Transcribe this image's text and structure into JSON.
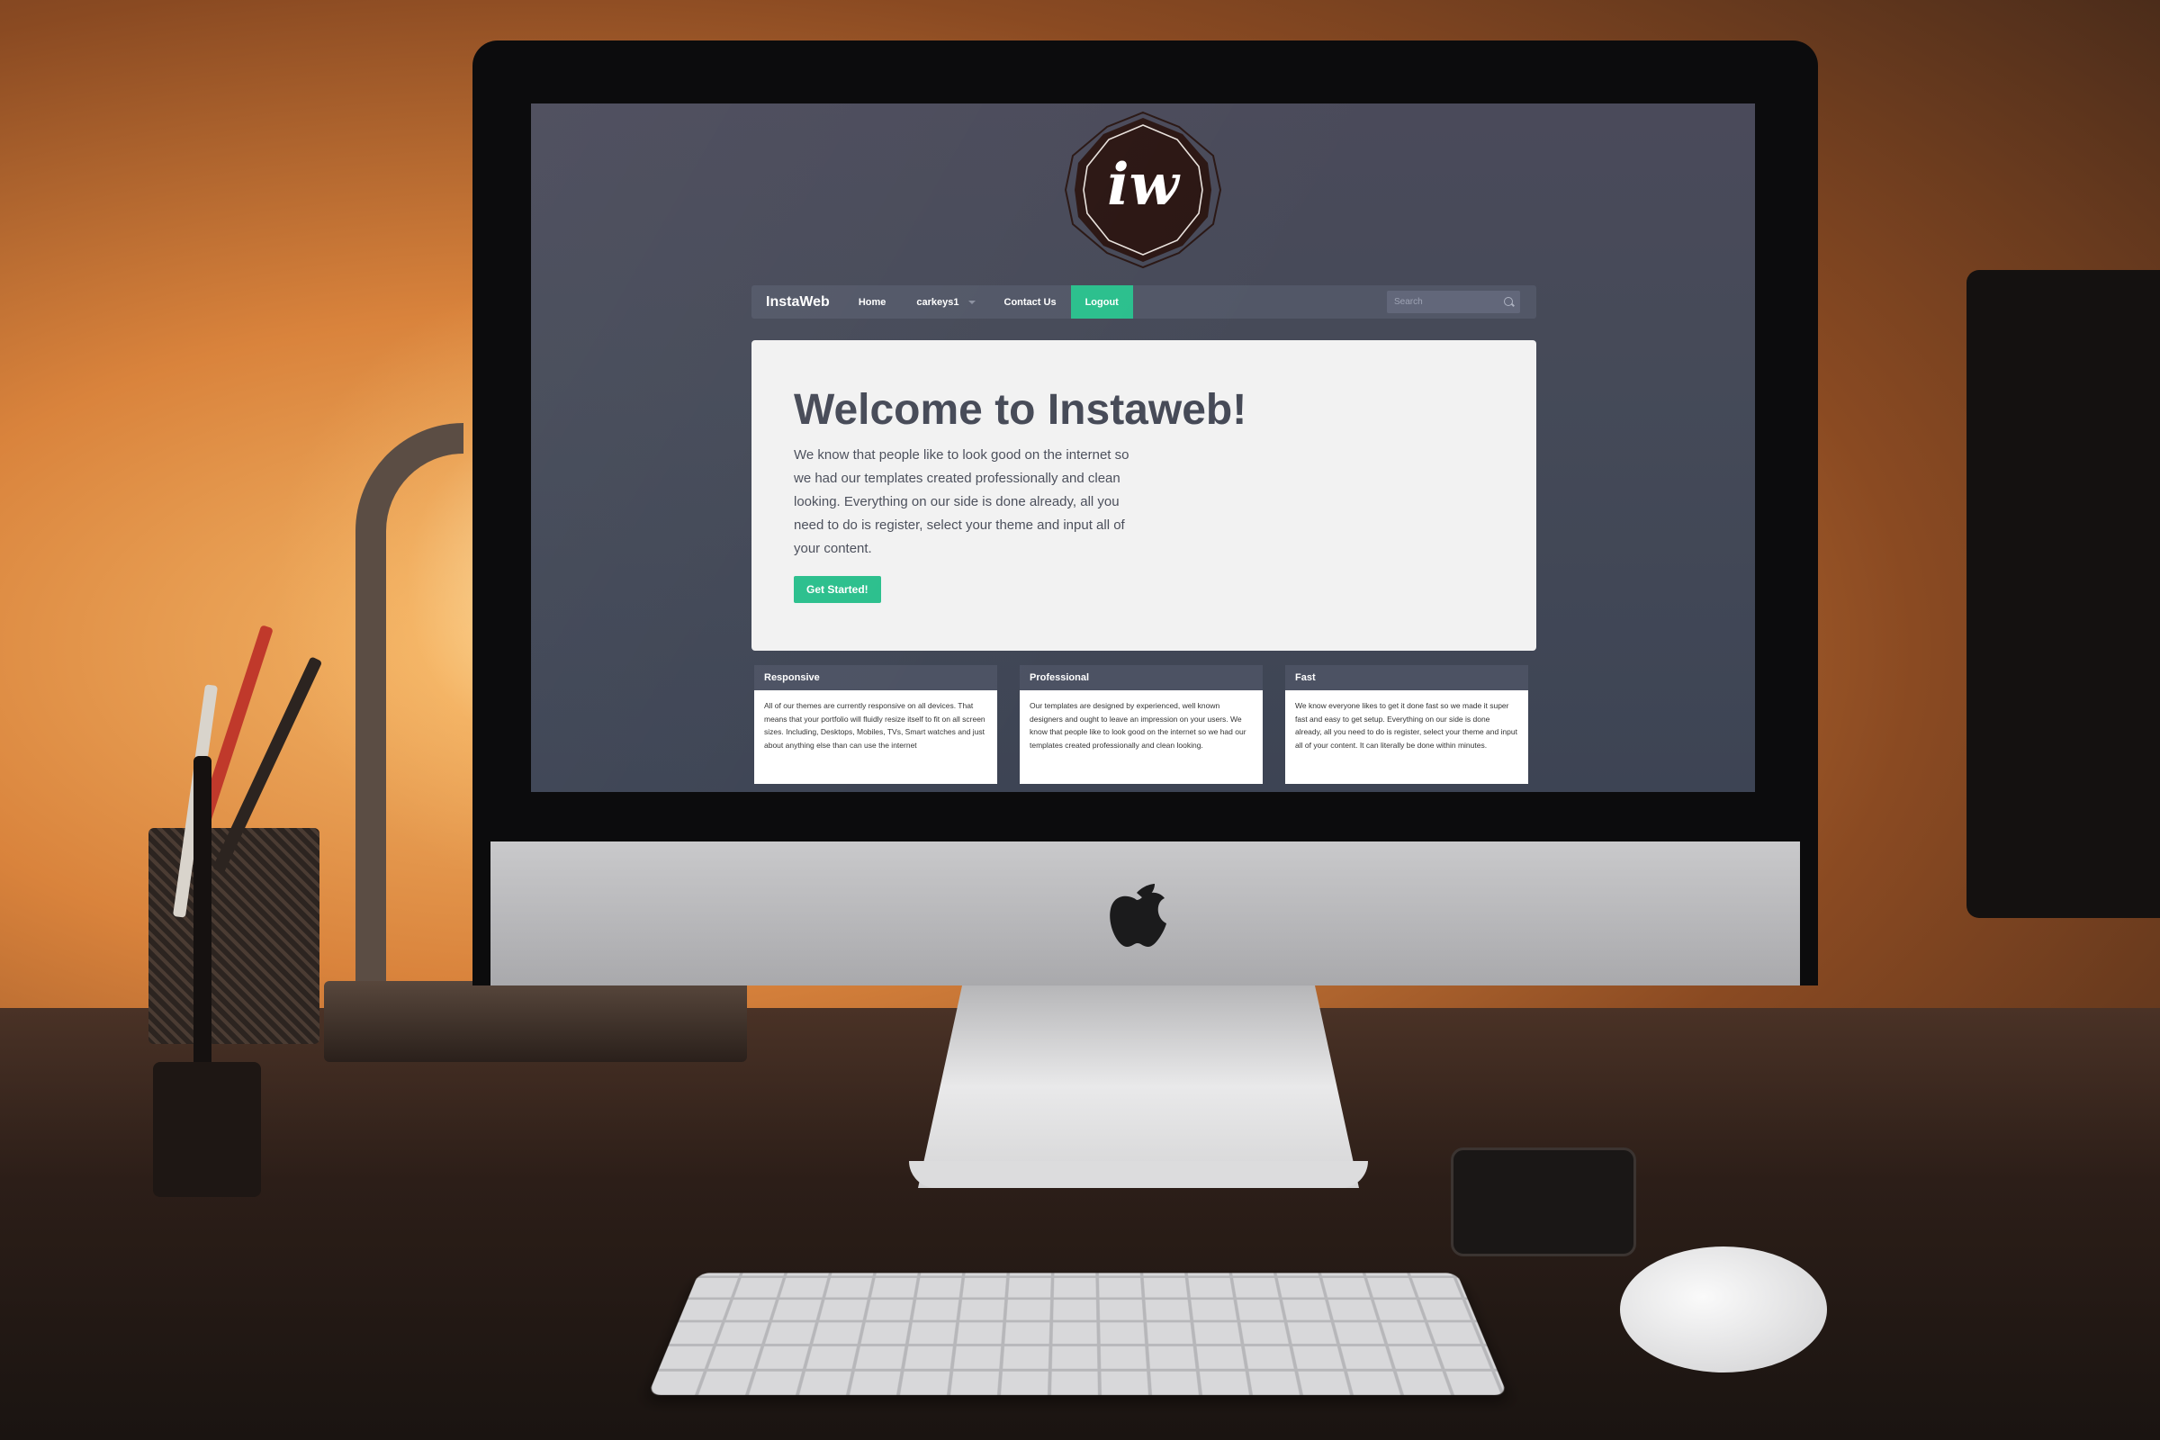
{
  "logo": {
    "icon": "instaweb-logo-icon",
    "mark": "iw"
  },
  "navbar": {
    "brand": "InstaWeb",
    "items": [
      {
        "label": "Home"
      },
      {
        "label": "carkeys1"
      },
      {
        "label": "Contact Us"
      },
      {
        "label": "Logout"
      }
    ],
    "search": {
      "placeholder": "Search",
      "icon": "search-icon"
    }
  },
  "jumbotron": {
    "title": "Welcome to Instaweb!",
    "text": "We know that people like to look good on the internet so we had our templates created professionally and clean looking. Everything on our side is done already, all you need to do is register, select your theme and input all of your content.",
    "button": "Get Started!"
  },
  "features": [
    {
      "title": "Responsive",
      "text": "All of our themes are currently responsive on all devices. That means that your portfolio will fluidly resize itself to fit on all screen sizes. Including, Desktops, Mobiles, TVs, Smart watches and just about anything else than can use the internet"
    },
    {
      "title": "Professional",
      "text": "Our templates are designed by experienced, well known designers and ought to leave an impression on your users. We know that people like to look good on the internet so we had our templates created professionally and clean looking."
    },
    {
      "title": "Fast",
      "text": "We know everyone likes to get it done fast so we made it super fast and easy to get setup. Everything on our side is done already, all you need to do is register, select your theme and input all of your content. It can literally be done within minutes."
    }
  ],
  "colors": {
    "accent": "#2bbf8d",
    "navbar": "#525767",
    "screen_bg": "#454a58",
    "text_dark": "#464a57"
  }
}
